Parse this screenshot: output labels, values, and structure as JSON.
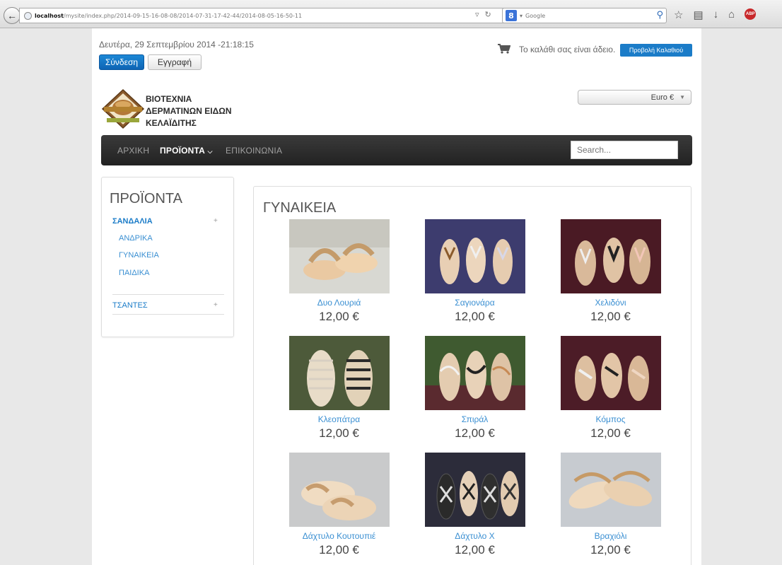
{
  "browser": {
    "url_host": "localhost",
    "url_path": "/mysite/index.php/2014-09-15-16-08-08/2014-07-31-17-42-44/2014-08-05-16-50-11",
    "search_engine_icon": "8",
    "search_placeholder": "Google",
    "abp_label": "ABP"
  },
  "header": {
    "date": "Δευτέρα, 29 Σεπτεμβρίου 2014 -21:18:15",
    "login_label": "Σύνδεση",
    "register_label": "Εγγραφή",
    "cart_text": "Το καλάθι σας είναι άδειο.",
    "cart_button": "Προβολή Καλαθιού",
    "brand_line1": "ΒΙΟΤΕΧΝΙΑ",
    "brand_line2": "ΔΕΡΜΑΤΙΝΩΝ ΕΙΔΩΝ",
    "brand_line3": "ΚΕΛΑΪΔΙΤΗΣ",
    "currency": "Euro €"
  },
  "nav": {
    "home": "ΑΡΧΙΚΗ",
    "products": "ΠΡΟΪΟΝΤΑ",
    "contact": "ΕΠΙΚΟΙΝΩΝΙΑ",
    "search_placeholder": "Search..."
  },
  "sidebar": {
    "title": "ΠΡΟΪΟΝΤΑ",
    "categories": [
      {
        "label": "ΣΑΝΔΑΛΙΑ",
        "expand": "+",
        "children": [
          "ΑΝΔΡΙΚΑ",
          "ΓΥΝΑΙΚΕΙΑ",
          "ΠΑΙΔΙΚΑ"
        ]
      },
      {
        "label": "ΤΣΑΝΤΕΣ",
        "expand": "+"
      }
    ]
  },
  "content": {
    "title": "ΓΥΝΑΙΚΕΙΑ",
    "products": [
      {
        "name": "Δυο Λουριά",
        "price": "12,00 €"
      },
      {
        "name": "Σαγιονάρα",
        "price": "12,00 €"
      },
      {
        "name": "Χελιδόνι",
        "price": "12,00 €"
      },
      {
        "name": "Κλεοπάτρα",
        "price": "12,00 €"
      },
      {
        "name": "Σπιράλ",
        "price": "12,00 €"
      },
      {
        "name": "Κόμπος",
        "price": "12,00 €"
      },
      {
        "name": "Δάχτυλο Κουτουπιέ",
        "price": "12,00 €"
      },
      {
        "name": "Δάχτυλο Χ",
        "price": "12,00 €"
      },
      {
        "name": "Βραχιόλι",
        "price": "12,00 €"
      }
    ]
  },
  "colors": {
    "accent": "#1b7cc8",
    "navbar": "#2a2a2a",
    "page_bg": "#e8e8e8"
  }
}
